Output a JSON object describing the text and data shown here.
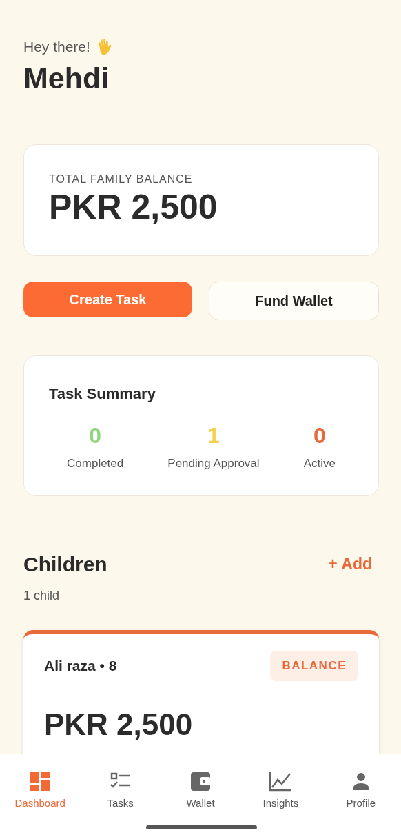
{
  "greeting": "Hey there!",
  "user_name": "Mehdi",
  "balance_card": {
    "label": "TOTAL FAMILY BALANCE",
    "amount": "PKR 2,500"
  },
  "actions": [
    {
      "label": "Create Task",
      "kind": "primary"
    },
    {
      "label": "Fund Wallet",
      "kind": "outline"
    }
  ],
  "task_summary": {
    "title": "Task Summary",
    "stats": [
      {
        "value": "0",
        "label": "Completed",
        "color": "#8fd67c"
      },
      {
        "value": "1",
        "label": "Pending Approval",
        "color": "#f2d04a"
      },
      {
        "value": "0",
        "label": "Active",
        "color": "#e8693a"
      }
    ]
  },
  "children_section": {
    "title": "Children",
    "add_link": "+ Add",
    "count": "1 child",
    "children": [
      {
        "name": "Ali raza • 8",
        "badge": "BALANCE",
        "amount": "PKR 2,500"
      }
    ]
  },
  "bottom_nav": [
    {
      "label": "Dashboard",
      "selected": true
    },
    {
      "label": "Tasks",
      "selected": false
    },
    {
      "label": "Wallet",
      "selected": false
    },
    {
      "label": "Insights",
      "selected": false
    },
    {
      "label": "Profile",
      "selected": false
    }
  ]
}
